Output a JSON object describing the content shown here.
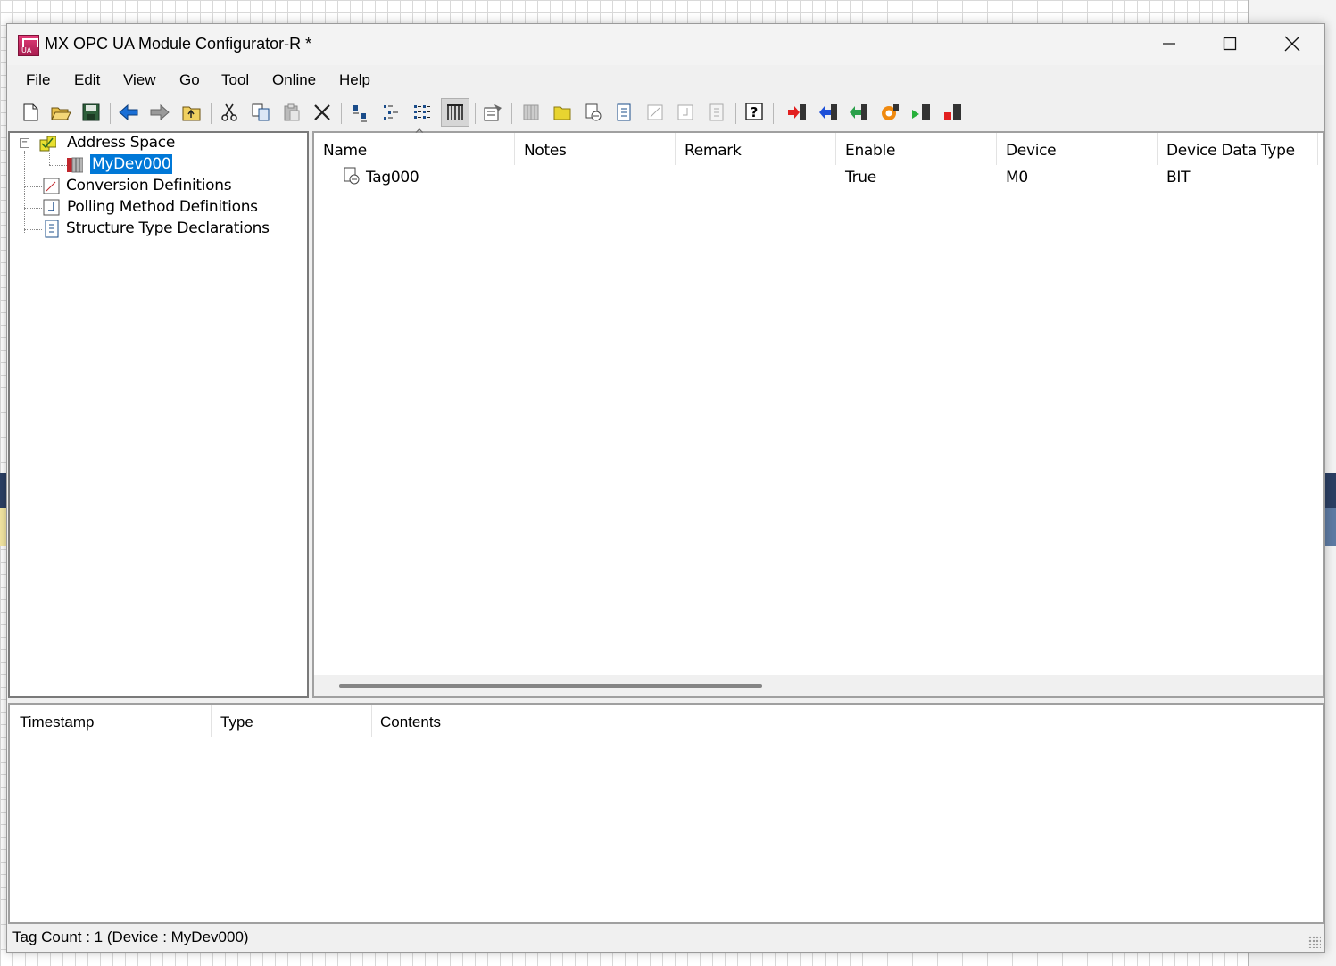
{
  "window": {
    "title": "MX OPC UA Module Configurator-R *"
  },
  "window_controls": {
    "minimize": "—",
    "maximize": "☐",
    "close": "✕"
  },
  "menu": [
    "File",
    "Edit",
    "View",
    "Go",
    "Tool",
    "Online",
    "Help"
  ],
  "toolbar": {
    "buttons": [
      "new-file",
      "open-folder",
      "save",
      "back",
      "forward",
      "up-folder",
      "cut",
      "copy",
      "paste",
      "delete",
      "large-icons",
      "small-icons",
      "list-view",
      "details-view",
      "properties",
      "add-device",
      "add-folder",
      "add-tag",
      "add-structure",
      "add-conversion",
      "add-polling",
      "add-struct-decl",
      "help",
      "write-to-module",
      "read-from-module",
      "verify-module",
      "reset-module",
      "start-module",
      "stop-module"
    ]
  },
  "tree": {
    "root": {
      "label": "Address Space",
      "expander": "−"
    },
    "device": {
      "label": "MyDev000"
    },
    "items": [
      "Conversion Definitions",
      "Polling Method Definitions",
      "Structure Type Declarations"
    ]
  },
  "list": {
    "sort_indicator": "^",
    "columns": [
      "Name",
      "Notes",
      "Remark",
      "Enable",
      "Device",
      "Device Data Type"
    ],
    "rows": [
      {
        "name": "Tag000",
        "notes": "",
        "remark": "",
        "enable": "True",
        "device": "M0",
        "device_data_type": "BIT"
      }
    ]
  },
  "log": {
    "columns": [
      "Timestamp",
      "Type",
      "Contents"
    ]
  },
  "status": {
    "text": "Tag Count : 1 (Device : MyDev000)"
  },
  "colors": {
    "selection": "#0078d7",
    "pane_border": "#7a7a7a"
  }
}
